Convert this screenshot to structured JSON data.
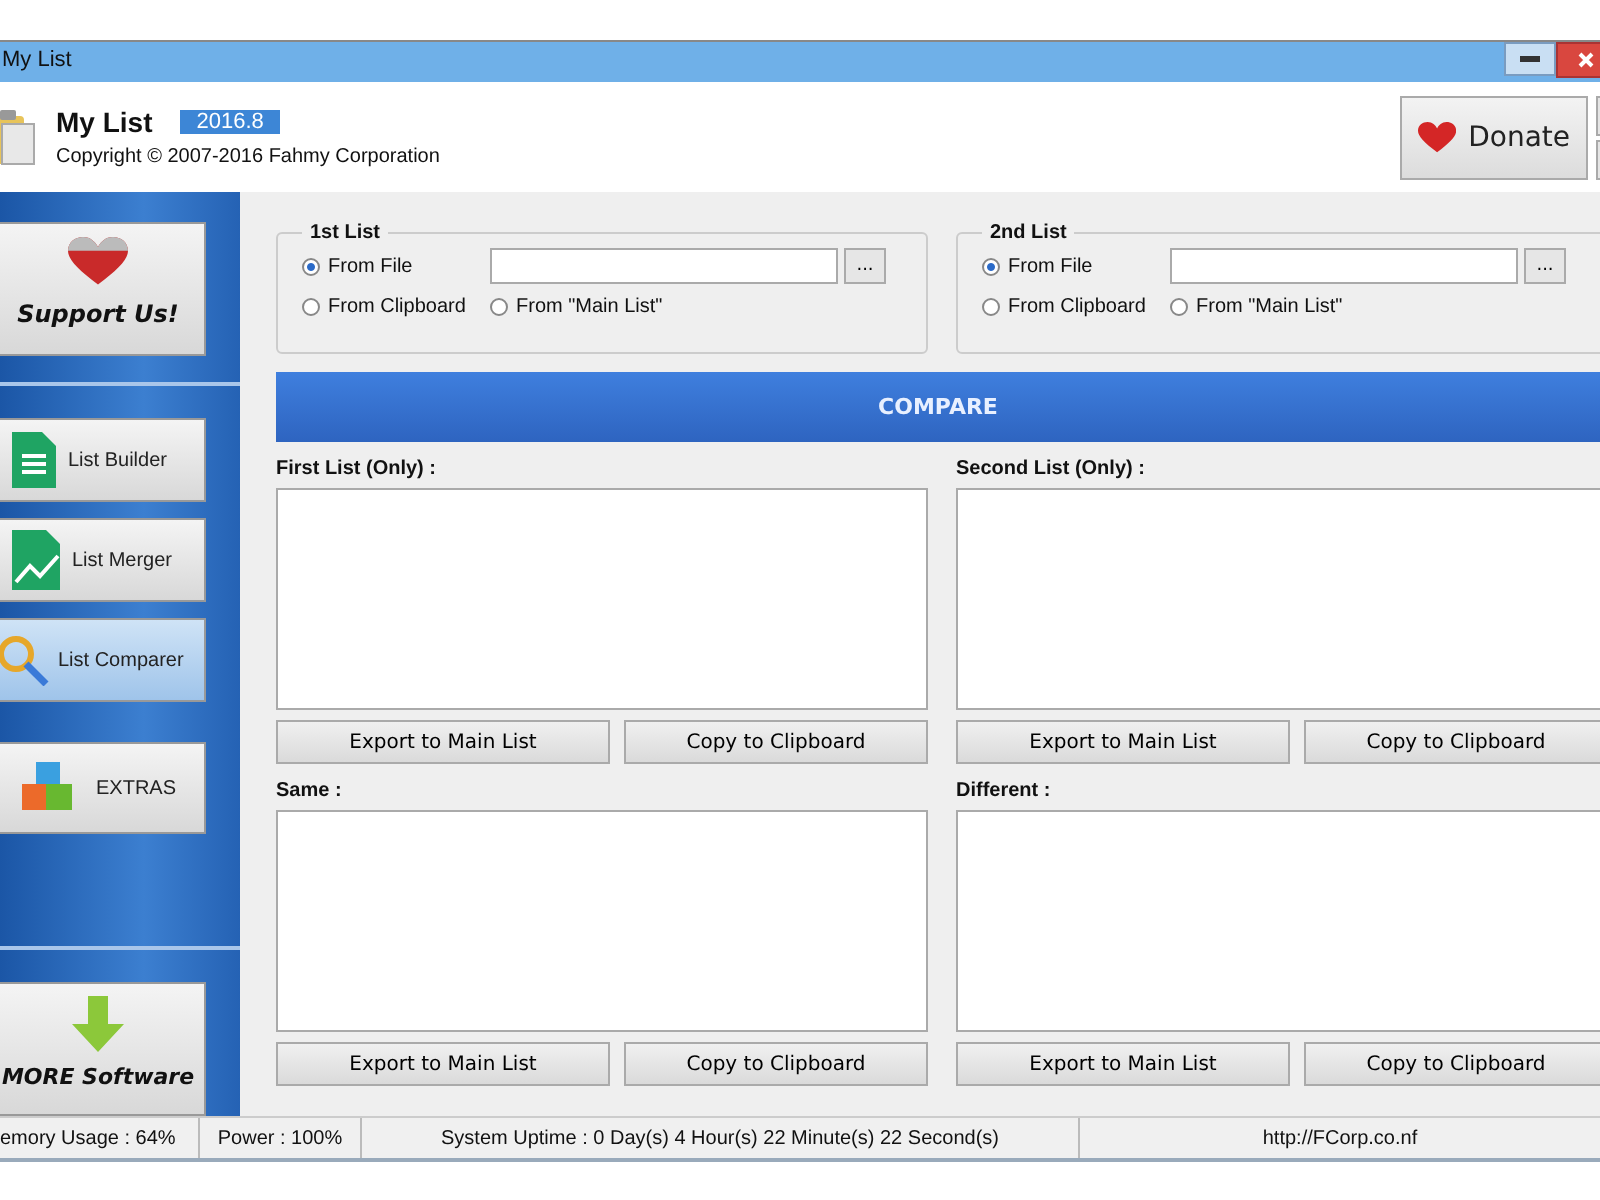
{
  "window": {
    "title": "My List"
  },
  "header": {
    "app_name": "My List",
    "version": "2016.8",
    "copyright": "Copyright © 2007-2016 Fahmy Corporation",
    "donate_button": "Donate"
  },
  "sidebar": {
    "support_button": "Support Us!",
    "items": [
      {
        "label": "List Builder",
        "selected": false
      },
      {
        "label": "List Merger",
        "selected": false
      },
      {
        "label": "List Comparer",
        "selected": true
      },
      {
        "label": "EXTRAS",
        "selected": false
      }
    ],
    "more_button": "MORE Software"
  },
  "sources": [
    {
      "title": "1st List",
      "browse_button": "...",
      "options": [
        {
          "label": "From File",
          "selected": true
        },
        {
          "label": "From Clipboard",
          "selected": false
        },
        {
          "label": "From \"Main List\"",
          "selected": false
        }
      ]
    },
    {
      "title": "2nd List",
      "browse_button": "...",
      "options": [
        {
          "label": "From File",
          "selected": true
        },
        {
          "label": "From Clipboard",
          "selected": false
        },
        {
          "label": "From \"Main List\"",
          "selected": false
        }
      ]
    }
  ],
  "compare_button": "COMPARE",
  "results": [
    {
      "title": "First List (Only) :",
      "buttons": [
        "Export to Main List",
        "Copy to Clipboard"
      ]
    },
    {
      "title": "Second List (Only) :",
      "buttons": [
        "Export to Main List",
        "Copy to Clipboard"
      ]
    },
    {
      "title": "Same :",
      "buttons": [
        "Export to Main List",
        "Copy to Clipboard"
      ]
    },
    {
      "title": "Different :",
      "buttons": [
        "Export to Main List",
        "Copy to Clipboard"
      ]
    }
  ],
  "status_bar": [
    "emory Usage : 64%",
    "Power : 100%",
    "System Uptime : 0 Day(s) 4 Hour(s) 22 Minute(s) 22 Second(s)",
    "http://FCorp.co.nf"
  ]
}
